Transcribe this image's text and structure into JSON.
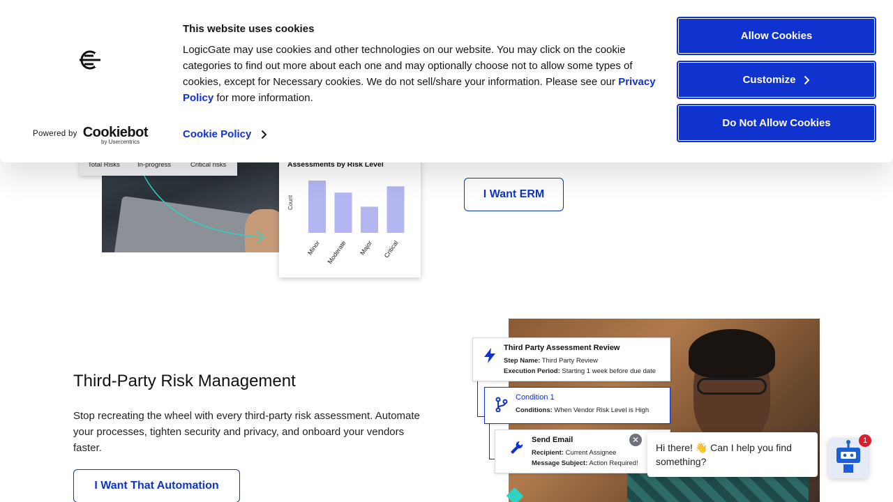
{
  "cookie_banner": {
    "title": "This website uses cookies",
    "body_text": "LogicGate may use cookies and other technologies on our website. You may click on the cookie categories to find out more about each one and may optionally choose not to allow some types of cookies, except for Necessary cookies.  We do not sell/share your information. Please see our ",
    "privacy_link": "Privacy Policy",
    "body_suffix": " for more information.",
    "cookie_policy_link": "Cookie Policy",
    "powered_by": "Powered by",
    "brand": "Cookiebot",
    "brand_sub": "by Usercentrics",
    "buttons": {
      "allow": "Allow Cookies",
      "customize": "Customize",
      "deny": "Do Not Allow Cookies"
    },
    "accent_color": "#1032cf"
  },
  "stats_card": {
    "labels": [
      "Total Risks",
      "In-progress",
      "Critical risks"
    ]
  },
  "risk_chart": {
    "title": "Assessments by Risk Level",
    "ylabel": "Count"
  },
  "chart_data": {
    "type": "bar",
    "title": "Assessments by Risk Level",
    "xlabel": "",
    "ylabel": "Count",
    "categories": [
      "Minor",
      "Moderate",
      "Major",
      "Critical"
    ],
    "values": [
      10,
      7.7,
      5.0,
      8.9
    ],
    "ylim": [
      0,
      10
    ],
    "grid": false,
    "bar_color": "#b4b6f2"
  },
  "erm_section": {
    "cta": "I Want ERM"
  },
  "tprm_section": {
    "title": "Third-Party Risk Management",
    "description": "Stop recreating the wheel with every third-party risk assessment. Automate your processes, tighten security and privacy, and onboard your vendors faster.",
    "cta": "I Want That Automation"
  },
  "workflow": {
    "cards": [
      {
        "title": "Third Party Assessment Review",
        "line1_label": "Step Name:",
        "line1_value": " Third Party Review",
        "line2_label": "Execution Period:",
        "line2_value": " Starting 1 week before due date",
        "icon": "lightning-icon"
      },
      {
        "title": "Condition 1",
        "line1_label": "Conditions:",
        "line1_value": " When Vendor Risk Level is High",
        "icon": "branch-icon"
      },
      {
        "title": "Send Email",
        "line1_label": "Recipient:",
        "line1_value": " Current Assignee",
        "line2_label": "Message Subject:",
        "line2_value": " Action Required!",
        "icon": "wrench-icon"
      }
    ]
  },
  "chat": {
    "message": "Hi there! 👋 Can I help you find something?",
    "badge_count": "1",
    "close_glyph": "✕"
  }
}
